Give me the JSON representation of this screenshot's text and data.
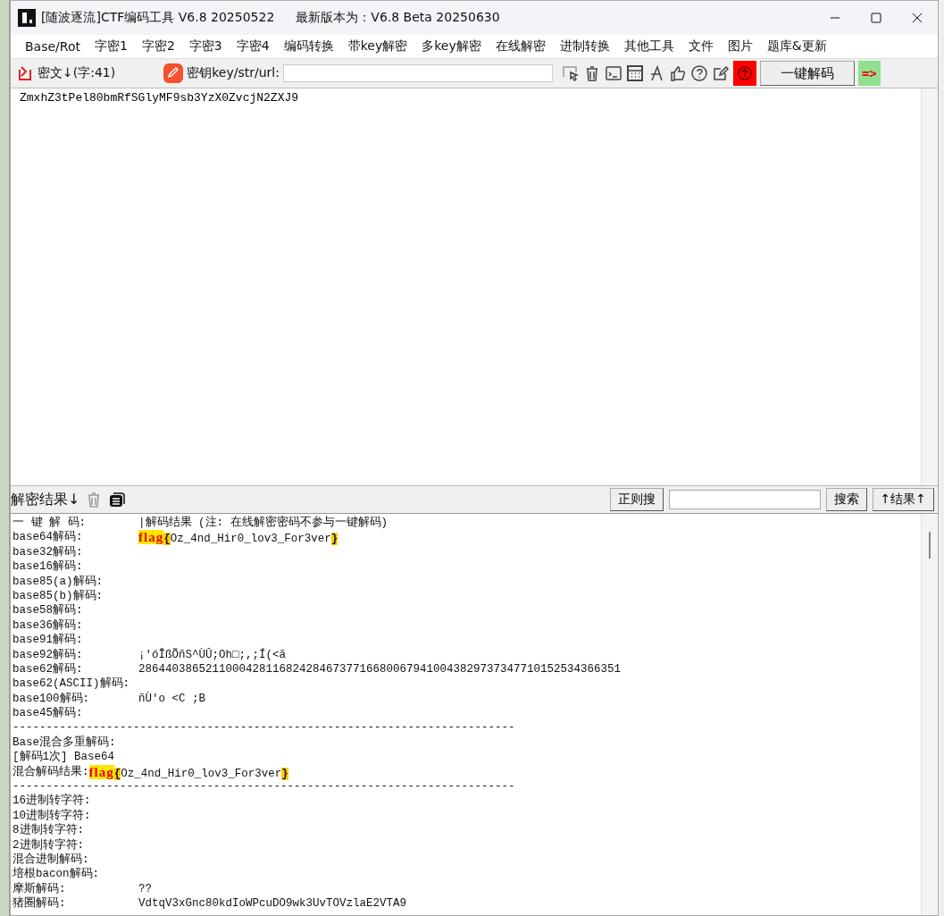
{
  "window": {
    "title": "[随波逐流]CTF编码工具 V6.8 20250522",
    "latest_version": "最新版本为：V6.8 Beta 20250630"
  },
  "menu": [
    "Base/Rot",
    "字密1",
    "字密2",
    "字密3",
    "字密4",
    "编码转换",
    "带key解密",
    "多key解密",
    "在线解密",
    "进制转换",
    "其他工具",
    "文件",
    "图片",
    "题库&更新"
  ],
  "toolbar": {
    "ciphertext_label": "密文↓(字:41)",
    "key_label": "密钥key/str/url:",
    "decode_all_button": "一键解码",
    "arrow": "=>"
  },
  "ciphertext": "ZmxhZ3tPel80bmRfSGlyMF9sb3YzX0ZvcjN2ZXJ9",
  "results_bar": {
    "label": "解密结果↓",
    "regex_button": "正则搜",
    "search_button": "搜索",
    "results_button": "↑结果↑"
  },
  "results": [
    {
      "kind": "line",
      "label": "一 键 解 码:",
      "value": "|解码结果 (注: 在线解密密码不参与一键解码)"
    },
    {
      "kind": "flag",
      "label": "base64解码:",
      "keyword": "flag",
      "open": "{",
      "body": "Oz_4nd_Hir0_lov3_For3ver",
      "close": "}"
    },
    {
      "kind": "line",
      "label": "base32解码:"
    },
    {
      "kind": "line",
      "label": "base16解码:"
    },
    {
      "kind": "line",
      "label": "base85(a)解码:"
    },
    {
      "kind": "line",
      "label": "base85(b)解码:"
    },
    {
      "kind": "line",
      "label": "base58解码:"
    },
    {
      "kind": "line",
      "label": "base36解码:"
    },
    {
      "kind": "line",
      "label": "base91解码:"
    },
    {
      "kind": "line",
      "label": "base92解码:",
      "value": "¡'óÎßÕñS^ÙÛ;Oh□;,;Í(<ã"
    },
    {
      "kind": "line",
      "label": "base62解码:",
      "value": "286440386521100042811682428467377166800679410043829737347710152534366351"
    },
    {
      "kind": "line",
      "label": "base62(ASCII)解码:"
    },
    {
      "kind": "line",
      "label": "base100解码:",
      "value": "ñÙ'o <C ;B"
    },
    {
      "kind": "line",
      "label": "base45解码:"
    },
    {
      "kind": "separator",
      "label": "---------------------------------------------------------------------------"
    },
    {
      "kind": "line",
      "label": "Base混合多重解码:"
    },
    {
      "kind": "line",
      "label": "[解码1次] Base64"
    },
    {
      "kind": "inline_flag",
      "label": "混合解码结果:",
      "keyword": "flag",
      "open": "{",
      "body": "Oz_4nd_Hir0_lov3_For3ver",
      "close": "}"
    },
    {
      "kind": "separator",
      "label": "---------------------------------------------------------------------------"
    },
    {
      "kind": "line",
      "label": "16进制转字符:"
    },
    {
      "kind": "line",
      "label": "10进制转字符:"
    },
    {
      "kind": "line",
      "label": "8进制转字符:"
    },
    {
      "kind": "line",
      "label": "2进制转字符:"
    },
    {
      "kind": "line",
      "label": "混合进制解码:"
    },
    {
      "kind": "line",
      "label": "培根bacon解码:"
    },
    {
      "kind": "line",
      "label": "摩斯解码:",
      "value": "??"
    },
    {
      "kind": "line",
      "label": "猪圈解码:",
      "value": "VdtqV3xGnc80kdIoWPcuDO9wk3UvTOVzlaE2VTA9"
    }
  ]
}
